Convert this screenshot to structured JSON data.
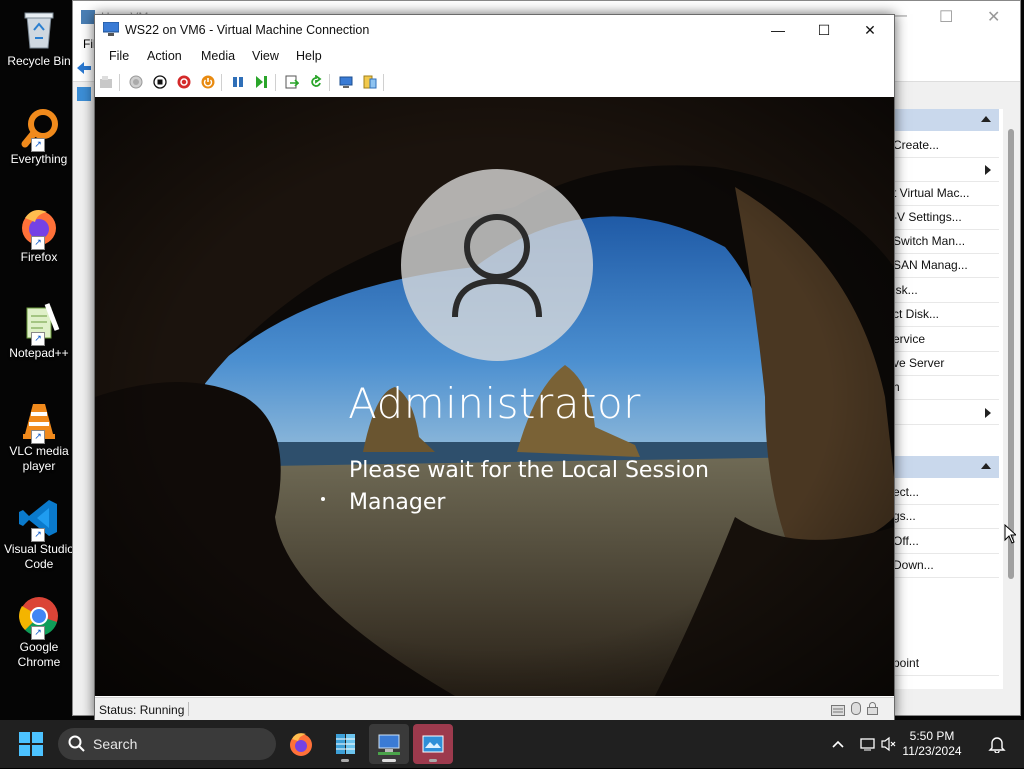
{
  "desktop": {
    "icons": [
      {
        "label": "Recycle Bin",
        "icon": "recycle-bin-icon"
      },
      {
        "label": "Everything",
        "icon": "everything-search-icon"
      },
      {
        "label": "Firefox",
        "icon": "firefox-icon"
      },
      {
        "label": "Notepad++",
        "icon": "notepad-plus-plus-icon"
      },
      {
        "label": "VLC media player",
        "icon": "vlc-icon"
      },
      {
        "label": "Visual Studio Code",
        "icon": "vscode-icon"
      },
      {
        "label": "Google Chrome",
        "icon": "chrome-icon"
      }
    ]
  },
  "background_window": {
    "menu_fragment": "Fil",
    "title_fragment": "H... - VM...",
    "actions": [
      {
        "label": "Create..."
      },
      {
        "label": ""
      },
      {
        "label": "t Virtual Mac..."
      },
      {
        "label": "-V Settings..."
      },
      {
        "label": "Switch Man..."
      },
      {
        "label": "SAN Manag..."
      },
      {
        "label": "isk..."
      },
      {
        "label": "ct Disk..."
      },
      {
        "label": "ervice"
      },
      {
        "label": "ve Server"
      },
      {
        "label": "h"
      },
      {
        "label": ""
      }
    ],
    "vm_actions": [
      {
        "label": "ect..."
      },
      {
        "label": "gs..."
      },
      {
        "label": "Off..."
      },
      {
        "label": "Down..."
      },
      {
        "label": "point"
      }
    ]
  },
  "vm_window": {
    "title": "WS22 on VM6 - Virtual Machine Connection",
    "controls": {
      "minimize": "—",
      "maximize": "☐",
      "close": "✕"
    },
    "menu": [
      "File",
      "Action",
      "Media",
      "View",
      "Help"
    ],
    "login": {
      "username": "Administrator",
      "message": "Please wait for the Local Session Manager"
    },
    "status": "Status: Running"
  },
  "taskbar": {
    "search_placeholder": "Search",
    "time": "5:50 PM",
    "date": "11/23/2024"
  },
  "colors": {
    "toolbar_red": "#d42a2a",
    "toolbar_orange": "#e88a10",
    "toolbar_green": "#2aa52a",
    "toolbar_blue": "#2f6fb8",
    "taskbar_bg": "#202020",
    "sky_blue": "#3a78c4"
  }
}
